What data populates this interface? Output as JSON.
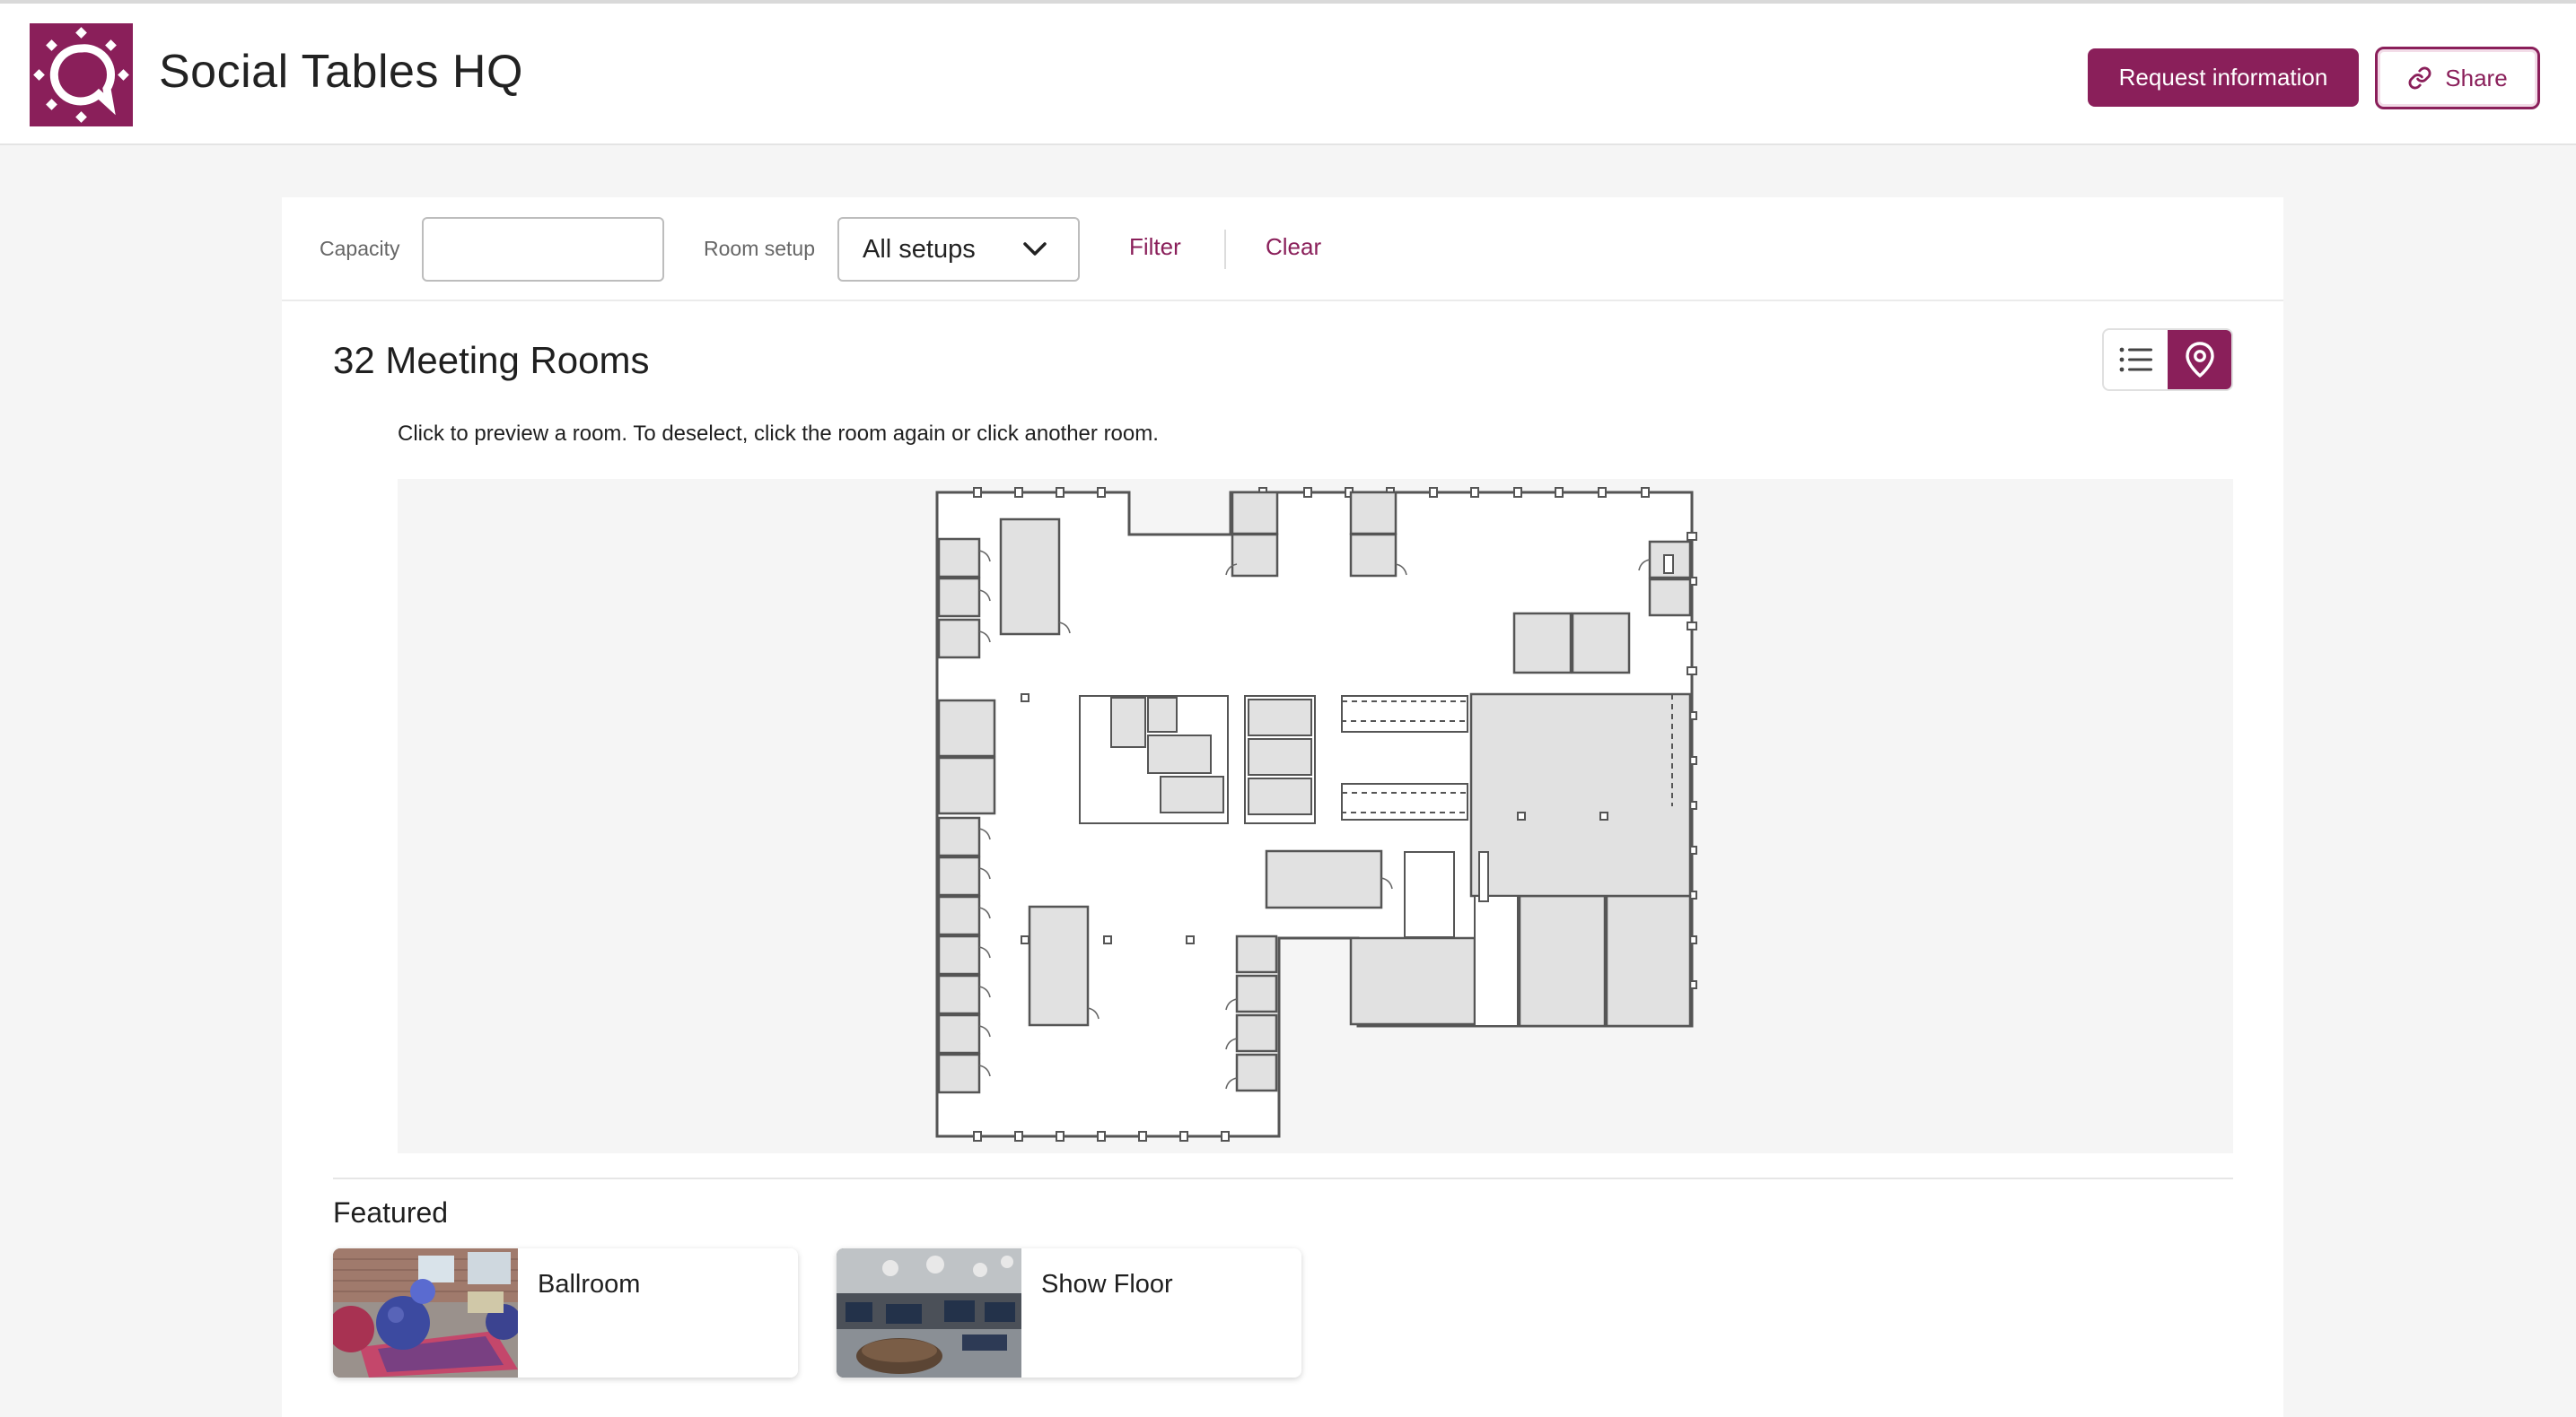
{
  "header": {
    "title": "Social Tables HQ",
    "request_label": "Request information",
    "share_label": "Share",
    "brand_color": "#8a1f5a"
  },
  "filters": {
    "capacity_label": "Capacity",
    "capacity_value": "",
    "room_setup_label": "Room setup",
    "room_setup_value": "All setups",
    "filter_label": "Filter",
    "clear_label": "Clear"
  },
  "results": {
    "title": "32 Meeting Rooms",
    "view_mode": "map",
    "hint": "Click to preview a room. To deselect, click the room again or click another room."
  },
  "featured": {
    "title": "Featured",
    "items": [
      {
        "name": "Ballroom"
      },
      {
        "name": "Show Floor"
      }
    ]
  },
  "icons": {
    "logo": "social-tables-logo",
    "share": "link-icon",
    "list_view": "list-icon",
    "map_view": "map-pin-icon",
    "dropdown": "chevron-down-icon"
  }
}
